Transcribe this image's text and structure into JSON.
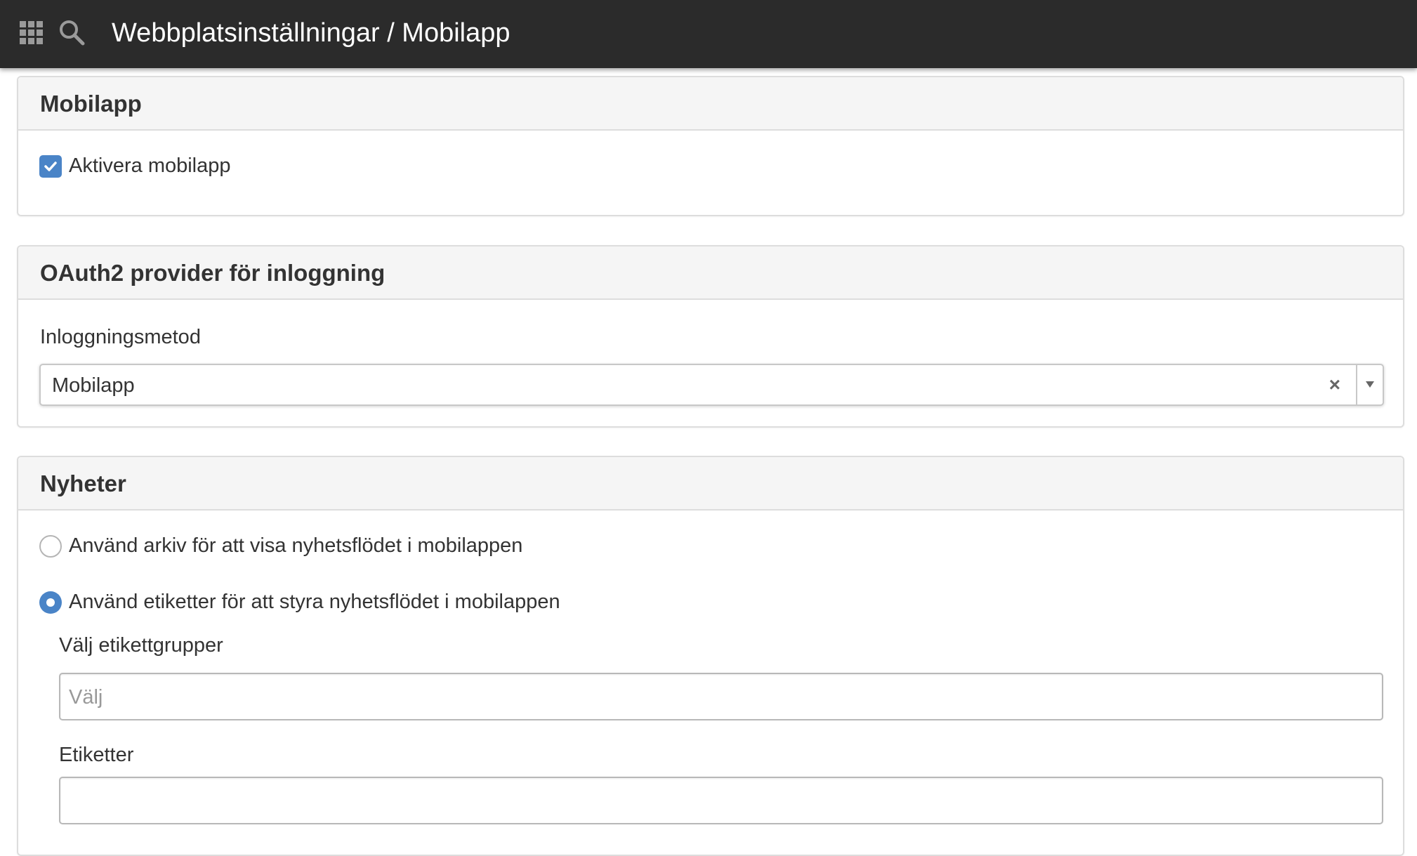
{
  "header": {
    "title": "Webbplatsinställningar / Mobilapp",
    "icons": [
      "apps-grid-icon",
      "search-icon"
    ]
  },
  "panels": {
    "mobilapp": {
      "title": "Mobilapp",
      "enable_checkbox": {
        "label": "Aktivera mobilapp",
        "checked": true
      }
    },
    "oauth": {
      "title": "OAuth2 provider för inloggning",
      "login_method_label": "Inloggningsmetod",
      "login_method_value": "Mobilapp",
      "clear_symbol": "×"
    },
    "news": {
      "title": "Nyheter",
      "options": [
        {
          "label": "Använd arkiv för att visa nyhetsflödet i mobilappen",
          "selected": false
        },
        {
          "label": "Använd etiketter för att styra nyhetsflödet i mobilappen",
          "selected": true
        }
      ],
      "tag_groups_label": "Välj etikettgrupper",
      "tag_groups_placeholder": "Välj",
      "tags_label": "Etiketter",
      "tags_value": ""
    }
  },
  "colors": {
    "topbar": "#2b2b2b",
    "accent": "#4a84c7",
    "panel_header": "#f5f5f5",
    "border": "#dddddd"
  }
}
